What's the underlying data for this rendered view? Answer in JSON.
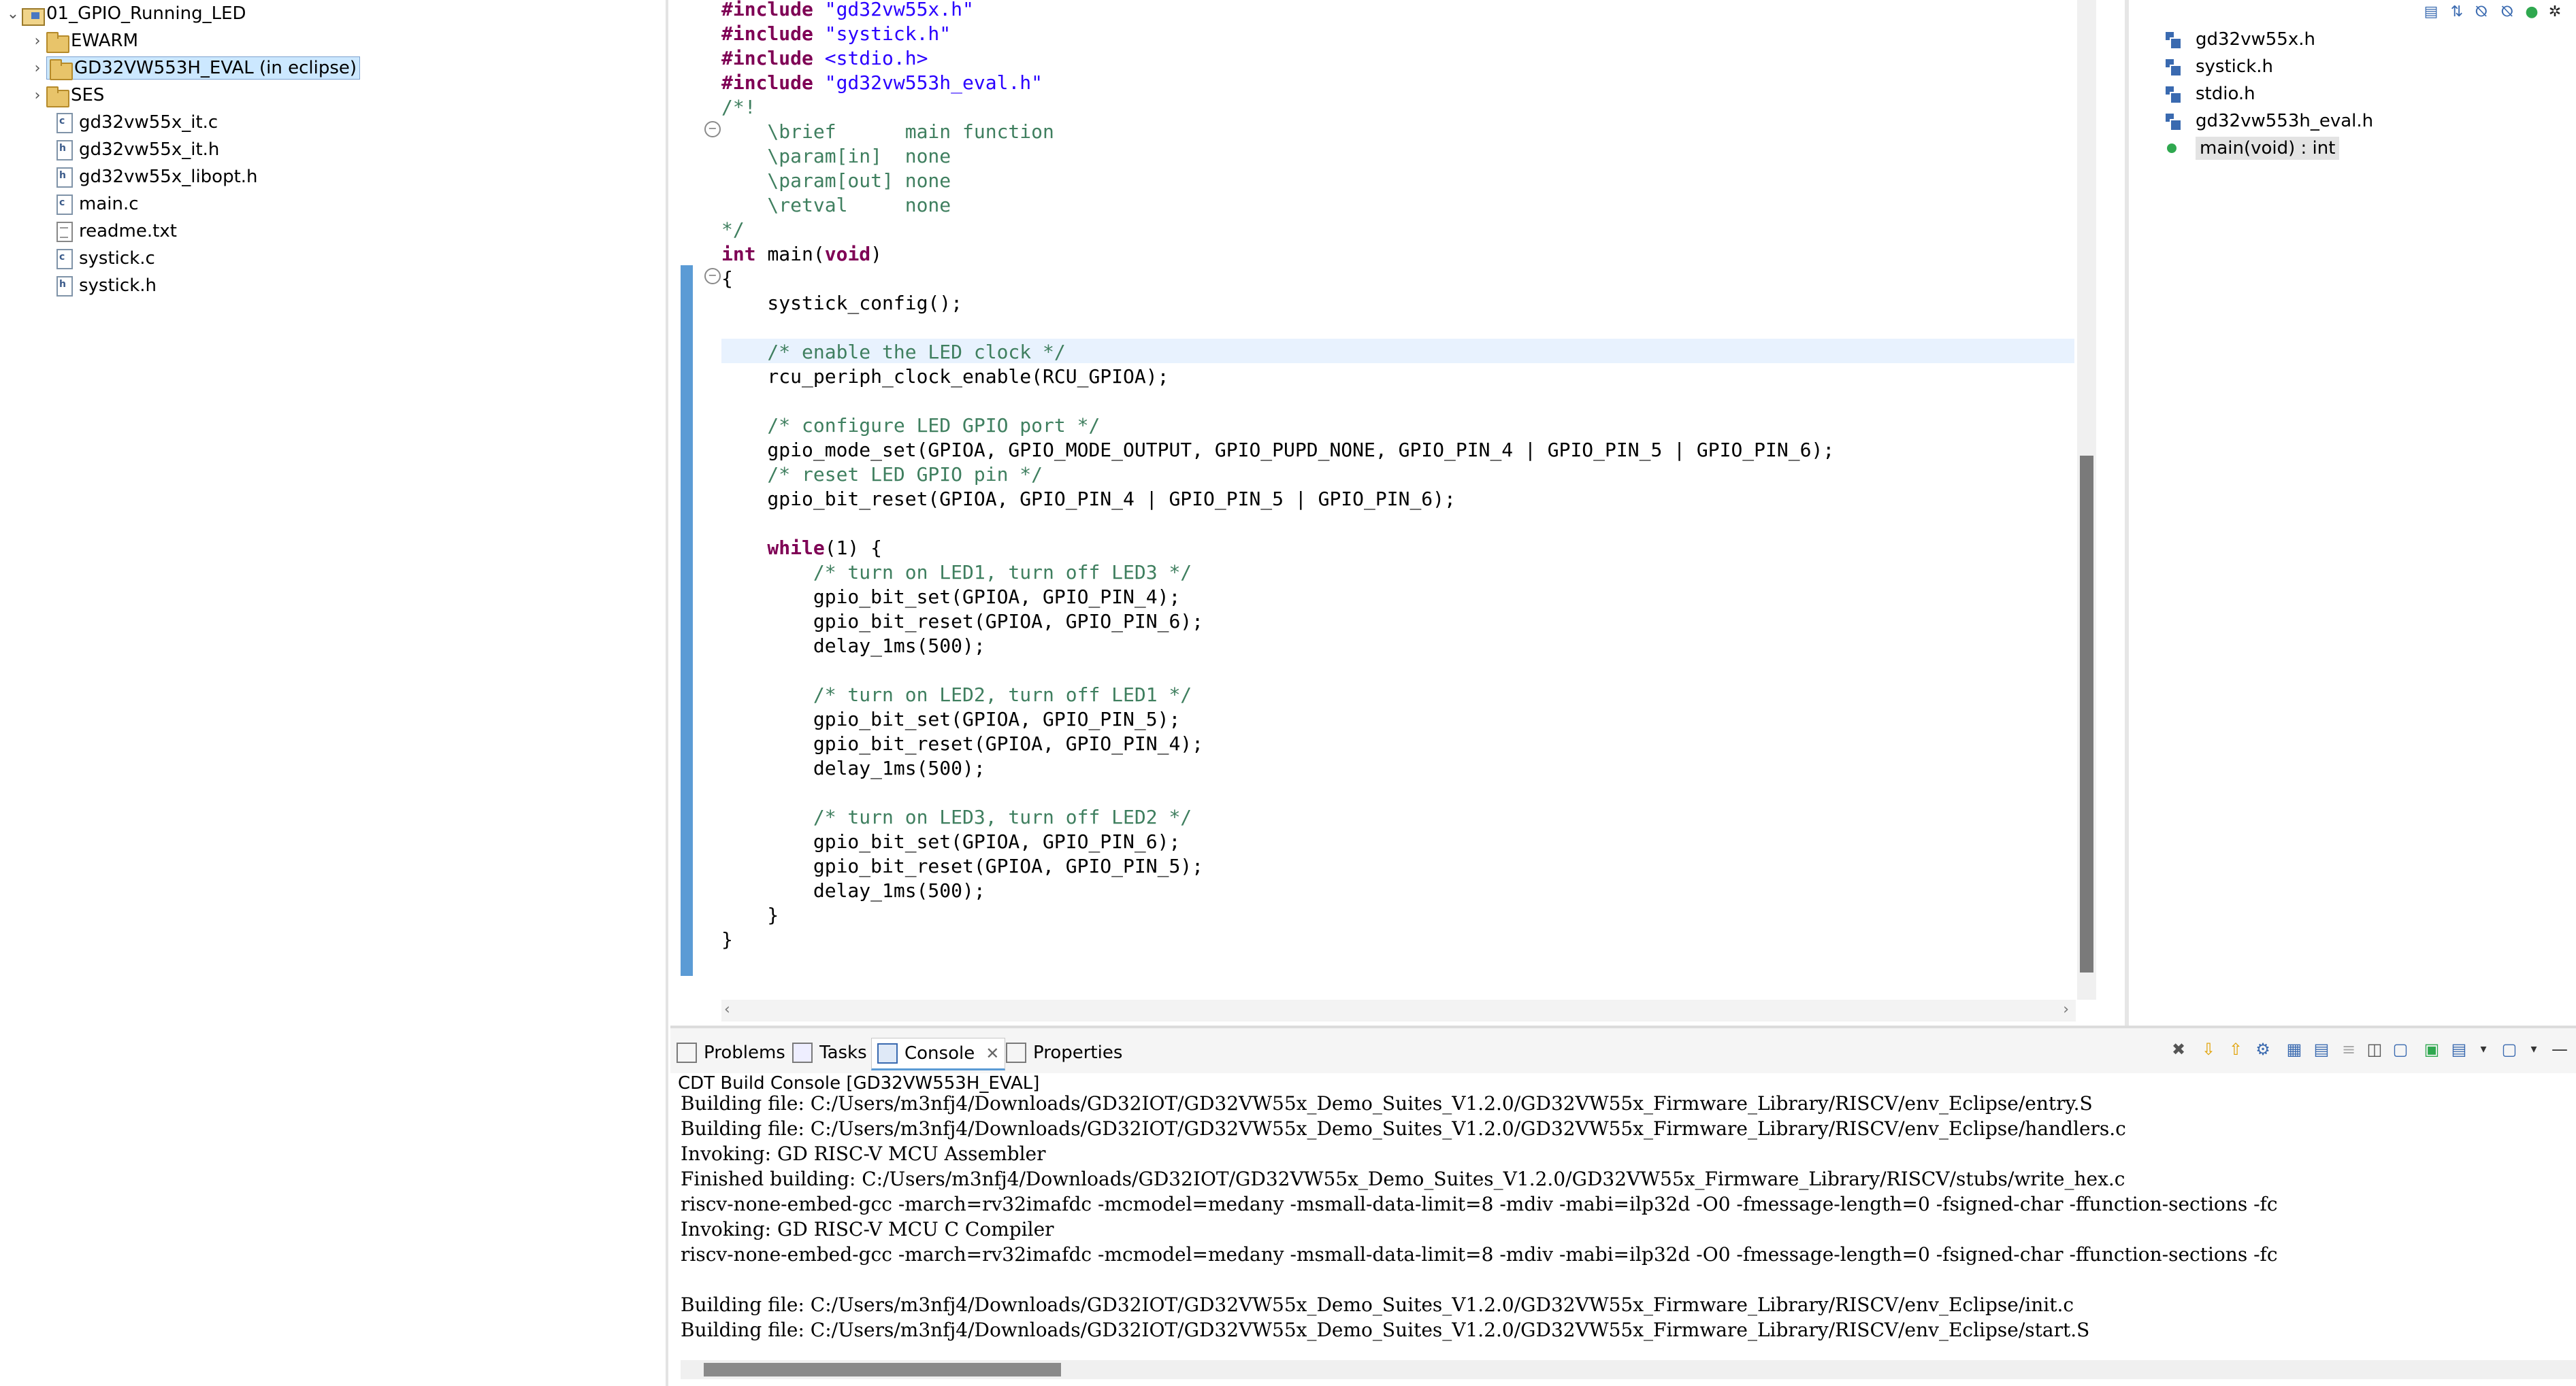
{
  "explorer": {
    "project": "01_GPIO_Running_LED",
    "items": [
      {
        "label": "EWARM"
      },
      {
        "label": "GD32VW553H_EVAL (in eclipse)"
      },
      {
        "label": "SES"
      },
      {
        "label": "gd32vw55x_it.c"
      },
      {
        "label": "gd32vw55x_it.h"
      },
      {
        "label": "gd32vw55x_libopt.h"
      },
      {
        "label": "main.c"
      },
      {
        "label": "readme.txt"
      },
      {
        "label": "systick.c"
      },
      {
        "label": "systick.h"
      }
    ]
  },
  "editor": {
    "lines": [
      {
        "a": "#include ",
        "b": "\"gd32vw55x.h\""
      },
      {
        "a": "#include ",
        "b": "\"systick.h\""
      },
      {
        "a": "#include ",
        "b": "<stdio.h>"
      },
      {
        "a": "#include ",
        "b": "\"gd32vw553h_eval.h\""
      },
      {
        "t": "/*!"
      },
      {
        "t": "    \\brief      main function"
      },
      {
        "t": "    \\param[in]  none"
      },
      {
        "t": "    \\param[out] none"
      },
      {
        "t": "    \\retval     none"
      },
      {
        "t": "*/"
      },
      {
        "k1": "int ",
        "f": "main",
        "p1": "(",
        "k2": "void",
        "p2": ")"
      },
      {
        "t": "{"
      },
      {
        "t": "    systick_config();"
      },
      {
        "t": ""
      },
      {
        "t": "    /* enable the LED clock */"
      },
      {
        "t": "    rcu_periph_clock_enable(RCU_GPIOA);"
      },
      {
        "t": ""
      },
      {
        "t": "    /* configure LED GPIO port */"
      },
      {
        "t": "    gpio_mode_set(GPIOA, GPIO_MODE_OUTPUT, GPIO_PUPD_NONE, GPIO_PIN_4 | GPIO_PIN_5 | GPIO_PIN_6);"
      },
      {
        "t": "    /* reset LED GPIO pin */"
      },
      {
        "t": "    gpio_bit_reset(GPIOA, GPIO_PIN_4 | GPIO_PIN_5 | GPIO_PIN_6);"
      },
      {
        "t": ""
      },
      {
        "k1": "    while",
        "p1": "(1) {"
      },
      {
        "t": "        /* turn on LED1, turn off LED3 */"
      },
      {
        "t": "        gpio_bit_set(GPIOA, GPIO_PIN_4);"
      },
      {
        "t": "        gpio_bit_reset(GPIOA, GPIO_PIN_6);"
      },
      {
        "t": "        delay_1ms(500);"
      },
      {
        "t": ""
      },
      {
        "t": "        /* turn on LED2, turn off LED1 */"
      },
      {
        "t": "        gpio_bit_set(GPIOA, GPIO_PIN_5);"
      },
      {
        "t": "        gpio_bit_reset(GPIOA, GPIO_PIN_4);"
      },
      {
        "t": "        delay_1ms(500);"
      },
      {
        "t": ""
      },
      {
        "t": "        /* turn on LED3, turn off LED2 */"
      },
      {
        "t": "        gpio_bit_set(GPIOA, GPIO_PIN_6);"
      },
      {
        "t": "        gpio_bit_reset(GPIOA, GPIO_PIN_5);"
      },
      {
        "t": "        delay_1ms(500);"
      },
      {
        "t": "    }"
      },
      {
        "t": "}"
      }
    ]
  },
  "outline": {
    "items": [
      {
        "label": "gd32vw55x.h",
        "icon": "include-icon"
      },
      {
        "label": "systick.h",
        "icon": "include-icon"
      },
      {
        "label": "stdio.h",
        "icon": "include-icon"
      },
      {
        "label": "gd32vw553h_eval.h",
        "icon": "include-icon"
      },
      {
        "label": "main(void) : int",
        "icon": "function-icon"
      }
    ]
  },
  "console": {
    "tabs": [
      {
        "label": "Problems"
      },
      {
        "label": "Tasks"
      },
      {
        "label": "Console"
      },
      {
        "label": "Properties"
      }
    ],
    "title": "CDT Build Console [GD32VW553H_EVAL]",
    "lines": [
      "Building file: C:/Users/m3nfj4/Downloads/GD32IOT/GD32VW55x_Demo_Suites_V1.2.0/GD32VW55x_Firmware_Library/RISCV/env_Eclipse/entry.S",
      "Building file: C:/Users/m3nfj4/Downloads/GD32IOT/GD32VW55x_Demo_Suites_V1.2.0/GD32VW55x_Firmware_Library/RISCV/env_Eclipse/handlers.c",
      "Invoking: GD RISC-V MCU Assembler",
      "Finished building: C:/Users/m3nfj4/Downloads/GD32IOT/GD32VW55x_Demo_Suites_V1.2.0/GD32VW55x_Firmware_Library/RISCV/stubs/write_hex.c",
      "riscv-none-embed-gcc -march=rv32imafdc -mcmodel=medany -msmall-data-limit=8 -mdiv -mabi=ilp32d -O0 -fmessage-length=0 -fsigned-char -ffunction-sections -fc",
      "Invoking: GD RISC-V MCU C Compiler",
      "riscv-none-embed-gcc -march=rv32imafdc -mcmodel=medany -msmall-data-limit=8 -mdiv -mabi=ilp32d -O0 -fmessage-length=0 -fsigned-char -ffunction-sections -fc",
      "",
      "Building file: C:/Users/m3nfj4/Downloads/GD32IOT/GD32VW55x_Demo_Suites_V1.2.0/GD32VW55x_Firmware_Library/RISCV/env_Eclipse/init.c",
      "Building file: C:/Users/m3nfj4/Downloads/GD32IOT/GD32VW55x_Demo_Suites_V1.2.0/GD32VW55x_Firmware_Library/RISCV/env_Eclipse/start.S"
    ]
  }
}
